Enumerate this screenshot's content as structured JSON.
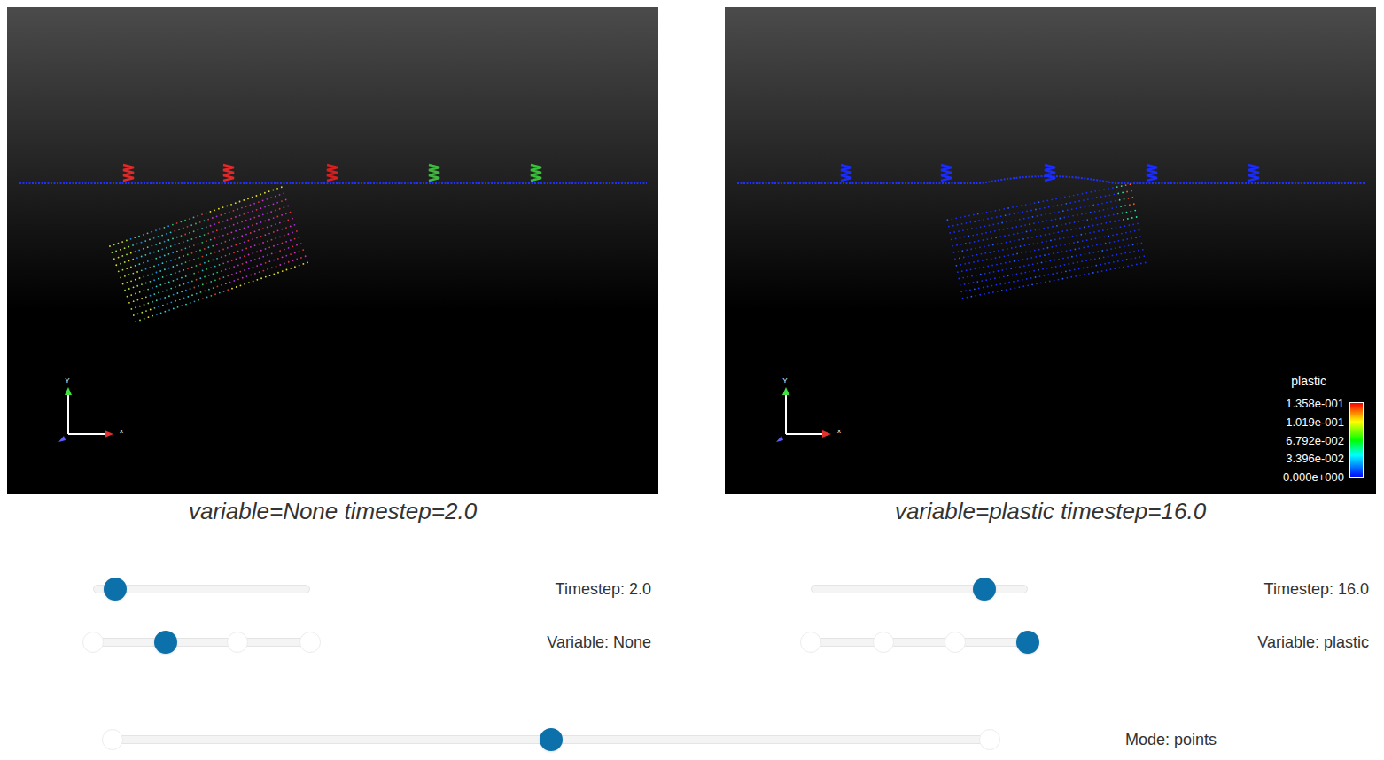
{
  "views": [
    {
      "caption": "variable=None timestep=2.0",
      "coloring": "mixed",
      "barrier_bent": false,
      "axes": {
        "x": "x",
        "y": "Y"
      },
      "posts": [
        {
          "color": "#e02a2a"
        },
        {
          "color": "#e02a2a"
        },
        {
          "color": "#d81f1f"
        },
        {
          "color": "#3fb83f"
        },
        {
          "color": "#38c038"
        }
      ],
      "legend": null,
      "timestep": {
        "label": "Timestep: 2.0",
        "level": 0.1
      },
      "variable": {
        "label": "Variable: None",
        "stops": [
          {
            "selected": false
          },
          {
            "selected": true
          },
          {
            "selected": false
          },
          {
            "selected": false
          }
        ]
      }
    },
    {
      "caption": "variable=plastic timestep=16.0",
      "coloring": "scalar",
      "barrier_bent": true,
      "axes": {
        "x": "x",
        "y": "Y"
      },
      "posts": [
        {
          "color": "#1a2cff"
        },
        {
          "color": "#1a2cff"
        },
        {
          "color": "#1a2cff"
        },
        {
          "color": "#1a2cff"
        },
        {
          "color": "#1a2cff"
        }
      ],
      "legend": {
        "title": "plastic",
        "ticks": [
          "1.358e-001",
          "1.019e-001",
          "6.792e-002",
          "3.396e-002",
          "0.000e+000"
        ]
      },
      "timestep": {
        "label": "Timestep: 16.0",
        "level": 0.8
      },
      "variable": {
        "label": "Variable: plastic",
        "stops": [
          {
            "selected": false
          },
          {
            "selected": false
          },
          {
            "selected": false
          },
          {
            "selected": true
          }
        ]
      }
    }
  ],
  "mode": {
    "label": "Mode: points",
    "stops": [
      {
        "selected": false
      },
      {
        "selected": true
      },
      {
        "selected": false
      }
    ]
  }
}
